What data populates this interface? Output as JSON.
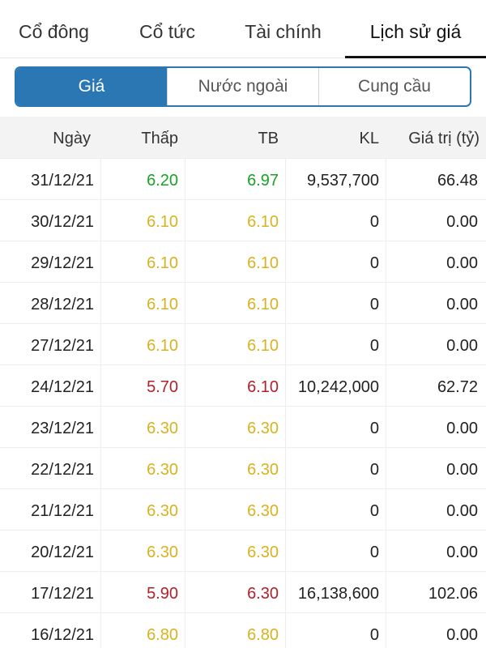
{
  "tabs": [
    {
      "label": "Cổ đông"
    },
    {
      "label": "Cổ tức"
    },
    {
      "label": "Tài chính"
    },
    {
      "label": "Lịch sử giá",
      "active": true
    }
  ],
  "segments": [
    {
      "label": "Giá",
      "active": true
    },
    {
      "label": "Nước ngoài"
    },
    {
      "label": "Cung cầu"
    }
  ],
  "colors": {
    "up": "#16a326",
    "ref": "#d9b21f",
    "down": "#b3202a",
    "accent": "#2a77b4"
  },
  "table": {
    "headers": [
      "Ngày",
      "Thấp",
      "TB",
      "KL",
      "Giá trị (tỷ)"
    ],
    "rows": [
      {
        "date": "31/12/21",
        "low": "6.20",
        "avg": "6.97",
        "vol": "9,537,700",
        "value": "66.48"
      },
      {
        "date": "30/12/21",
        "low": "6.10",
        "avg": "6.10",
        "vol": "0",
        "value": "0.00"
      },
      {
        "date": "29/12/21",
        "low": "6.10",
        "avg": "6.10",
        "vol": "0",
        "value": "0.00"
      },
      {
        "date": "28/12/21",
        "low": "6.10",
        "avg": "6.10",
        "vol": "0",
        "value": "0.00"
      },
      {
        "date": "27/12/21",
        "low": "6.10",
        "avg": "6.10",
        "vol": "0",
        "value": "0.00"
      },
      {
        "date": "24/12/21",
        "low": "5.70",
        "avg": "6.10",
        "vol": "10,242,000",
        "value": "62.72"
      },
      {
        "date": "23/12/21",
        "low": "6.30",
        "avg": "6.30",
        "vol": "0",
        "value": "0.00"
      },
      {
        "date": "22/12/21",
        "low": "6.30",
        "avg": "6.30",
        "vol": "0",
        "value": "0.00"
      },
      {
        "date": "21/12/21",
        "low": "6.30",
        "avg": "6.30",
        "vol": "0",
        "value": "0.00"
      },
      {
        "date": "20/12/21",
        "low": "6.30",
        "avg": "6.30",
        "vol": "0",
        "value": "0.00"
      },
      {
        "date": "17/12/21",
        "low": "5.90",
        "avg": "6.30",
        "vol": "16,138,600",
        "value": "102.06"
      },
      {
        "date": "16/12/21",
        "low": "6.80",
        "avg": "6.80",
        "vol": "0",
        "value": "0.00"
      }
    ]
  }
}
